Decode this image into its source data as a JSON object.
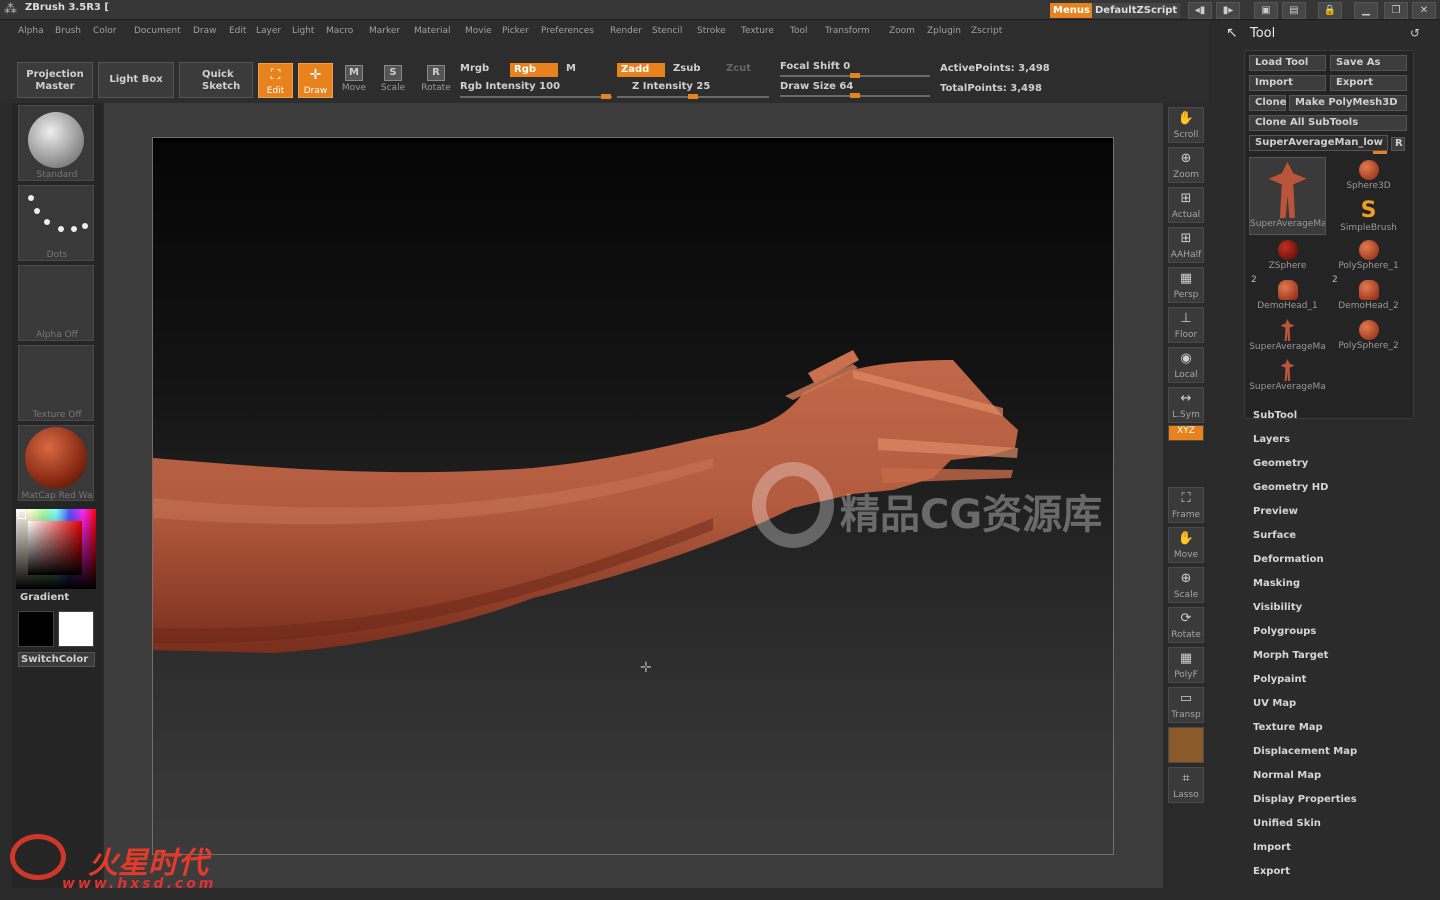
{
  "app": {
    "title": "ZBrush 3.5R3 [",
    "menus_button": "Menus",
    "script_name": "DefaultZScript"
  },
  "menubar": [
    "Alpha",
    "Brush",
    "Color",
    "Document",
    "Draw",
    "Edit",
    "Layer",
    "Light",
    "Macro",
    "Marker",
    "Material",
    "Movie",
    "Picker",
    "Preferences",
    "Render",
    "Stencil",
    "Stroke",
    "Texture",
    "Tool",
    "Transform",
    "Zoom",
    "Zplugin",
    "Zscript"
  ],
  "toolbar": {
    "projection_master": "Projection Master",
    "light_box": "Light Box",
    "quick_sketch": "Quick Sketch",
    "edit": "Edit",
    "draw": "Draw",
    "move": "Move",
    "scale": "Scale",
    "rotate": "Rotate",
    "mrgb": "Mrgb",
    "rgb": "Rgb",
    "m": "M",
    "rgb_intensity": "Rgb Intensity 100",
    "rgb_intensity_value": 100,
    "zadd": "Zadd",
    "zsub": "Zsub",
    "zcut": "Zcut",
    "z_intensity": "Z Intensity 25",
    "z_intensity_value": 25,
    "focal_shift": "Focal Shift 0",
    "focal_shift_value": 0,
    "draw_size": "Draw Size 64",
    "draw_size_value": 64,
    "active_points": "ActivePoints: 3,498",
    "total_points": "TotalPoints: 3,498"
  },
  "left": {
    "brush": "Standard",
    "stroke": "Dots",
    "alpha": "Alpha Off",
    "texture": "Texture Off",
    "material": "MatCap Red Wa",
    "gradient": "Gradient",
    "switch_color": "SwitchColor"
  },
  "right_tools": [
    "Scroll",
    "Zoom",
    "Actual",
    "AAHalf",
    "Persp",
    "Floor",
    "Local",
    "L.Sym",
    "XYZ",
    "Frame",
    "Move",
    "Scale",
    "Rotate",
    "PolyF",
    "Transp",
    "Lasso"
  ],
  "tool_panel": {
    "title": "Tool",
    "load_tool": "Load Tool",
    "save_as": "Save As",
    "import": "Import",
    "export": "Export",
    "clone": "Clone",
    "make_polymesh": "Make PolyMesh3D",
    "clone_all": "Clone All SubTools",
    "current_tool": "SuperAverageMan_low",
    "r": "R",
    "thumbs": [
      {
        "label": "SuperAverageMa",
        "count": ""
      },
      {
        "label": "Sphere3D",
        "count": ""
      },
      {
        "label": "SimpleBrush",
        "count": ""
      },
      {
        "label": "ZSphere",
        "count": ""
      },
      {
        "label": "PolySphere_1",
        "count": ""
      },
      {
        "label": "DemoHead_1",
        "count": "2"
      },
      {
        "label": "DemoHead_2",
        "count": "2"
      },
      {
        "label": "SuperAverageMa",
        "count": ""
      },
      {
        "label": "PolySphere_2",
        "count": ""
      },
      {
        "label": "SuperAverageMa",
        "count": ""
      }
    ],
    "sections": [
      "SubTool",
      "Layers",
      "Geometry",
      "Geometry HD",
      "Preview",
      "Surface",
      "Deformation",
      "Masking",
      "Visibility",
      "Polygroups",
      "Morph Target",
      "Polypaint",
      "UV Map",
      "Texture Map",
      "Displacement Map",
      "Normal Map",
      "Display Properties",
      "Unified Skin",
      "Import",
      "Export"
    ]
  },
  "watermark": "精品CG资源库",
  "corner_logo": "火星时代",
  "corner_url": "www.hxsd.com",
  "colors": {
    "accent": "#e8821d",
    "clay": "#b8563a"
  }
}
